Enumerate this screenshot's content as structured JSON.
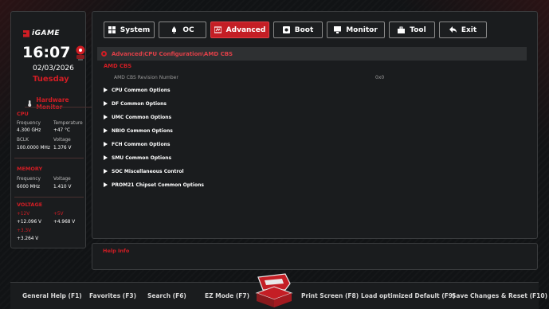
{
  "brand": {
    "logo_text": "iGAME"
  },
  "status": {
    "time": "16:07",
    "date": "02/03/2026",
    "weekday": "Tuesday"
  },
  "hardware_monitor": {
    "title": "Hardware Monitor",
    "cpu": {
      "heading": "CPU",
      "frequency_label": "Frequency",
      "frequency_value": "4.300 GHz",
      "temperature_label": "Temperature",
      "temperature_value": "+47 °C",
      "bclk_label": "BCLK",
      "bclk_value": "100.0000 MHz",
      "voltage_label": "Voltage",
      "voltage_value": "1.376 V"
    },
    "memory": {
      "heading": "MEMORY",
      "frequency_label": "Frequency",
      "frequency_value": "6000 MHz",
      "voltage_label": "Voltage",
      "voltage_value": "1.410 V"
    },
    "voltage": {
      "heading": "VOLTAGE",
      "v12_label": "+12V",
      "v12_value": "+12.096 V",
      "v5_label": "+5V",
      "v5_value": "+4.968 V",
      "v33_label": "+3.3V",
      "v33_value": "+3.264 V"
    }
  },
  "tabs": [
    {
      "label": "System",
      "icon": "grid-icon",
      "active": false
    },
    {
      "label": "OC",
      "icon": "rocket-icon",
      "active": false
    },
    {
      "label": "Advanced",
      "icon": "advanced-icon",
      "active": true
    },
    {
      "label": "Boot",
      "icon": "disk-icon",
      "active": false
    },
    {
      "label": "Monitor",
      "icon": "monitor-icon",
      "active": false
    },
    {
      "label": "Tool",
      "icon": "toolbox-icon",
      "active": false
    },
    {
      "label": "Exit",
      "icon": "return-icon",
      "active": false
    }
  ],
  "breadcrumb": "Advanced\\CPU Configuration\\AMD CBS",
  "page_title": "AMD CBS",
  "revision": {
    "label": "AMD CBS Revision Number",
    "value": "0x0"
  },
  "menu_items": [
    "CPU Common Options",
    "DF Common Options",
    "UMC Common Options",
    "NBIO Common Options",
    "FCH Common Options",
    "SMU Common Options",
    "SOC Miscellaneous Control",
    "PROM21 Chipset Common Options"
  ],
  "help": {
    "title": "Help Info"
  },
  "function_keys": {
    "general_help": "General Help (F1)",
    "favorites": "Favorites (F3)",
    "search": "Search (F6)",
    "ez_mode": "EZ Mode (F7)",
    "print_screen": "Print Screen (F8)",
    "load_defaults": "Load optimized Default (F9)",
    "save_reset": "Save Changes & Reset (F10)"
  },
  "colors": {
    "accent": "#d11d24",
    "active_tab": "#c41e25",
    "panel": "#1a1c1e",
    "background": "#111315"
  }
}
